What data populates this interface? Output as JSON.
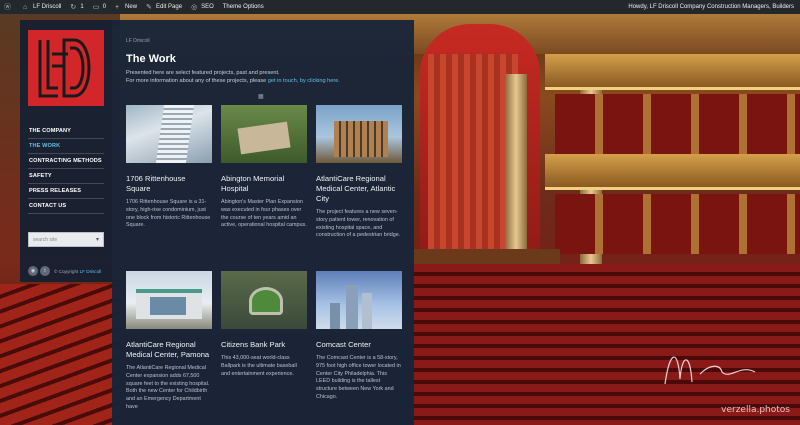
{
  "admin_bar": {
    "site_name": "LF Driscoll",
    "updates_count": "1",
    "comments_count": "0",
    "new_label": "New",
    "edit_page_label": "Edit Page",
    "seo_label": "SEO",
    "theme_options_label": "Theme Options",
    "howdy_text": "Howdy, LF Driscoll Company Construction Managers, Builders"
  },
  "sidebar": {
    "nav": [
      {
        "label": "THE COMPANY",
        "active": false
      },
      {
        "label": "THE WORK",
        "active": true
      },
      {
        "label": "CONTRACTING METHODS",
        "active": false
      },
      {
        "label": "SAFETY",
        "active": false
      },
      {
        "label": "PRESS RELEASES",
        "active": false
      },
      {
        "label": "CONTACT US",
        "active": false
      }
    ],
    "search_placeholder": "search site",
    "copyright_prefix": "© Copyright",
    "copyright_link": "LF Driscoll"
  },
  "main": {
    "breadcrumb": "LF Driscoll",
    "title": "The Work",
    "intro_line1": "Presented here are select featured projects, past and present.",
    "intro_line2": "For more information about any of these projects, please",
    "intro_link": "get in touch, by clicking here.",
    "projects": [
      {
        "title": "1706 Rittenhouse Square",
        "description": "1706 Rittenhouse Square is a 31-story, high-rise condominium, just one block from historic Rittenhouse Square."
      },
      {
        "title": "Abington Memorial Hospital",
        "description": "Abington's Master Plan Expansion was executed in four phases over the course of ten years amid an active, operational hospital campus."
      },
      {
        "title": "AtlantiCare Regional Medical Center, Atlantic City",
        "description": "The project features a new seven-story patient tower, renovation of existing hospital space, and construction of a pedestrian bridge."
      },
      {
        "title": "AtlantiCare Regional Medical Center, Pamona",
        "description": "The AtlantiCare Regional Medical Center expansion adds 67,500 square feet to the existing hospital. Both the new Center for Childbirth and an Emergency Department have"
      },
      {
        "title": "Citizens Bank Park",
        "description": "This 43,000-seat world-class Ballpark is the ultimate baseball and entertainment experience."
      },
      {
        "title": "Comcast Center",
        "description": "The Comcast Center is a 58-story, 975 foot high office tower located in Center City Philadelphia. This LEED building is the tallest structure between New York and Chicago."
      }
    ]
  },
  "watermark": "verzella.photos",
  "signature_text": "M. Verzella",
  "colors": {
    "brand_red": "#d3262b",
    "accent_blue": "#5ec3e8",
    "panel_bg": "#172539",
    "admin_bar_bg": "#23282d"
  },
  "icons": [
    "wordpress-icon",
    "home-icon",
    "updates-icon",
    "comments-icon",
    "plus-icon",
    "pencil-icon",
    "seo-icon",
    "grid-icon",
    "rss-icon",
    "twitter-icon",
    "search-dropdown-caret"
  ]
}
